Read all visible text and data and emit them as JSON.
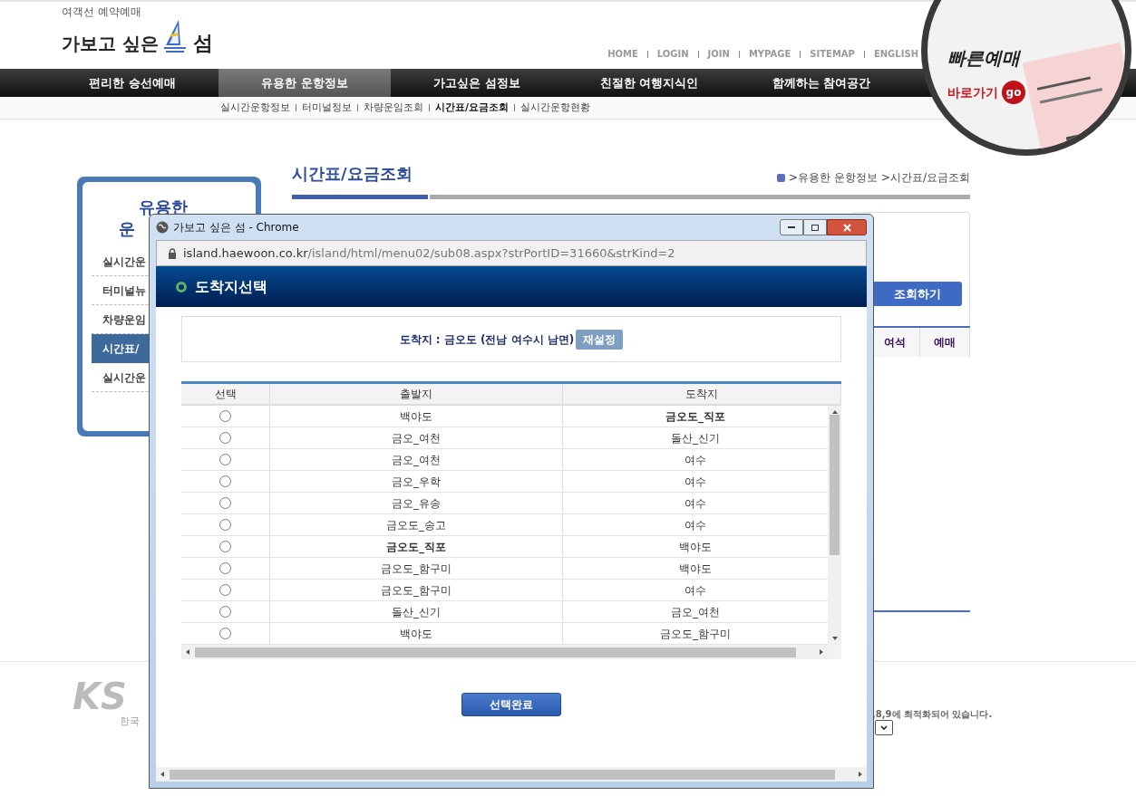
{
  "header": {
    "logo": {
      "tagline": "여객선 예약예매",
      "name_before": "가보고 싶은",
      "name_after": "섬"
    },
    "top_links": [
      "HOME",
      "LOGIN",
      "JOIN",
      "MYPAGE",
      "SITEMAP",
      "ENGLISH"
    ],
    "nav": [
      {
        "label": "편리한 승선예매",
        "selected": false
      },
      {
        "label": "유용한 운항정보",
        "selected": true
      },
      {
        "label": "가고싶은 섬정보",
        "selected": false
      },
      {
        "label": "친절한 여행지식인",
        "selected": false
      },
      {
        "label": "함께하는 참여공간",
        "selected": false
      }
    ],
    "subnav": [
      {
        "label": "실시간운항정보",
        "selected": false
      },
      {
        "label": "터미널정보",
        "selected": false
      },
      {
        "label": "차량운임조회",
        "selected": false
      },
      {
        "label": "시간표/요금조회",
        "selected": true
      },
      {
        "label": "실시간운항현황",
        "selected": false
      }
    ],
    "quick_booking": {
      "title": "빠른예매",
      "link": "바로가기",
      "go": "go"
    }
  },
  "sidebar": {
    "title_lines": [
      "유용한",
      "운"
    ],
    "items": [
      {
        "label": "실시간운",
        "selected": false
      },
      {
        "label": "터미널뉴",
        "selected": false
      },
      {
        "label": "차량운임",
        "selected": false
      },
      {
        "label": "시간표/",
        "selected": true
      },
      {
        "label": "실시간운",
        "selected": false
      }
    ]
  },
  "main": {
    "title": "시간표/요금조회",
    "breadcrumb": [
      ">유용한 운항정보",
      ">시간표/요금조회"
    ],
    "search_button": "조회하기",
    "tabs": [
      "여석",
      "예매"
    ]
  },
  "footer": {
    "logo_text": "KS",
    "logo_sub": "한국",
    "note": ",8,9에 최적화되어 있습니다."
  },
  "popup": {
    "title": "가보고 싶은 섬 - Chrome",
    "url_host": "island.haewoon.co.kr",
    "url_path": "/island/html/menu02/sub08.aspx?strPortID=31660&strKind=2",
    "heading": "도착지선택",
    "destination": "도착지 : 금오도 (전남 여수시 남면)",
    "reset_button": "재설정",
    "columns": [
      "선택",
      "출발지",
      "도착지"
    ],
    "rows": [
      {
        "selected": false,
        "departure": {
          "text": "백야도",
          "bold": false
        },
        "arrival": {
          "text": "금오도_직포",
          "bold": true
        }
      },
      {
        "selected": false,
        "departure": {
          "text": "금오_여천",
          "bold": false
        },
        "arrival": {
          "text": "돌산_신기",
          "bold": false
        }
      },
      {
        "selected": false,
        "departure": {
          "text": "금오_여천",
          "bold": false
        },
        "arrival": {
          "text": "여수",
          "bold": false
        }
      },
      {
        "selected": false,
        "departure": {
          "text": "금오_우학",
          "bold": false
        },
        "arrival": {
          "text": "여수",
          "bold": false
        }
      },
      {
        "selected": false,
        "departure": {
          "text": "금오_유송",
          "bold": false
        },
        "arrival": {
          "text": "여수",
          "bold": false
        }
      },
      {
        "selected": false,
        "departure": {
          "text": "금오도_송고",
          "bold": false
        },
        "arrival": {
          "text": "여수",
          "bold": false
        }
      },
      {
        "selected": false,
        "departure": {
          "text": "금오도_직포",
          "bold": true
        },
        "arrival": {
          "text": "백야도",
          "bold": false
        }
      },
      {
        "selected": false,
        "departure": {
          "text": "금오도_함구미",
          "bold": false
        },
        "arrival": {
          "text": "백야도",
          "bold": false
        }
      },
      {
        "selected": false,
        "departure": {
          "text": "금오도_함구미",
          "bold": false
        },
        "arrival": {
          "text": "여수",
          "bold": false
        }
      },
      {
        "selected": false,
        "departure": {
          "text": "돌산_신기",
          "bold": false
        },
        "arrival": {
          "text": "금오_여천",
          "bold": false
        }
      },
      {
        "selected": false,
        "departure": {
          "text": "백야도",
          "bold": false
        },
        "arrival": {
          "text": "금오도_함구미",
          "bold": false
        }
      }
    ],
    "confirm_button": "선택완료"
  }
}
